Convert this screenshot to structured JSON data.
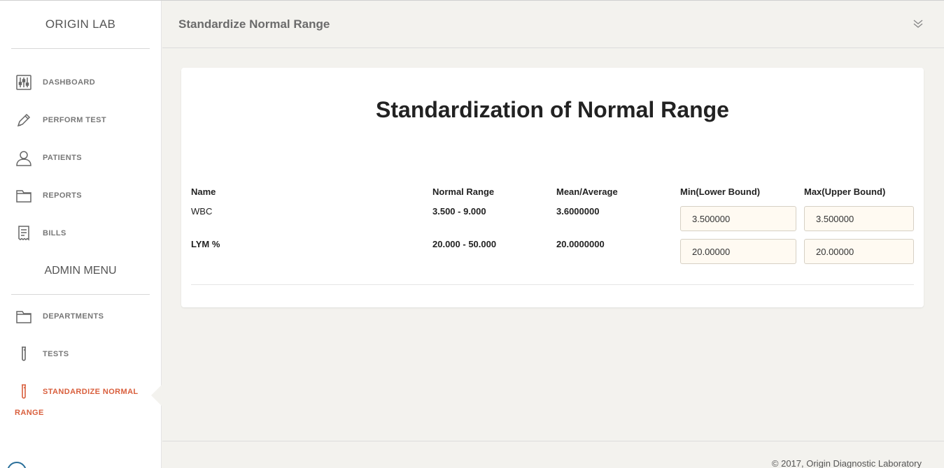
{
  "brand": "ORIGIN LAB",
  "nav": [
    {
      "label": "DASHBOARD",
      "icon": "sliders-icon"
    },
    {
      "label": "PERFORM TEST",
      "icon": "pencil-icon"
    },
    {
      "label": "PATIENTS",
      "icon": "user-icon"
    },
    {
      "label": "REPORTS",
      "icon": "folder-icon"
    },
    {
      "label": "BILLS",
      "icon": "receipt-icon"
    }
  ],
  "admin_menu": {
    "title": "ADMIN MENU",
    "items": [
      {
        "label": "DEPARTMENTS",
        "icon": "folder-icon"
      },
      {
        "label": "TESTS",
        "icon": "test-tube-icon"
      },
      {
        "label": "STANDARDIZE NORMAL",
        "label_line2": "RANGE",
        "icon": "test-tube-icon",
        "active": true
      }
    ]
  },
  "header": {
    "title": "Standardize Normal Range"
  },
  "card": {
    "title": "Standardization of Normal Range",
    "columns": [
      "Name",
      "Normal Range",
      "Mean/Average",
      "Min(Lower Bound)",
      "Max(Upper Bound)"
    ],
    "rows": [
      {
        "name": "WBC",
        "range": "3.500 - 9.000",
        "mean": "3.6000000",
        "min": "3.500000",
        "max": "3.500000"
      },
      {
        "name": "LYM %",
        "range": "20.000 - 50.000",
        "mean": "20.0000000",
        "min": "20.00000",
        "max": "20.00000"
      }
    ]
  },
  "footer": {
    "text": "© 2017, Origin Diagnostic Laboratory"
  },
  "colors": {
    "accent": "#d95f3d",
    "background": "#f3f2ee",
    "sidebar": "#ffffff"
  }
}
